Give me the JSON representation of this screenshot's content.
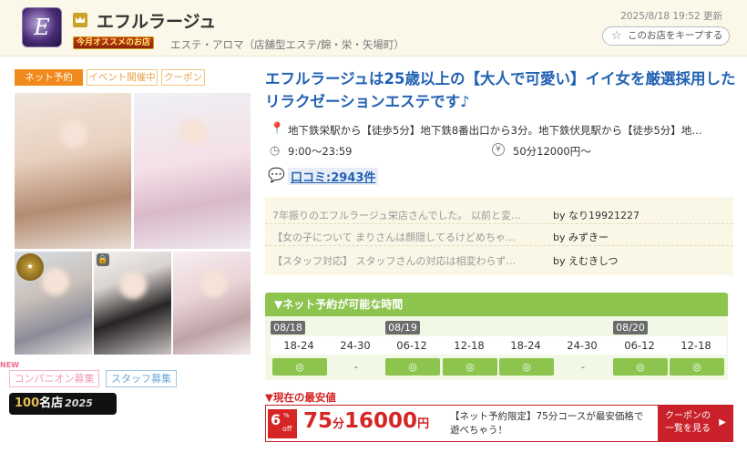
{
  "header": {
    "shop_name": "エフルラージュ",
    "badge": "今月オススメのお店",
    "category": "エステ・アロマ（店舗型エステ/錦・栄・矢場町）",
    "updated": "2025/8/18 19:52 更新",
    "keep_label": "このお店をキープする"
  },
  "tags": [
    "ネット予約",
    "イベント開催中",
    "クーポン"
  ],
  "recruit": {
    "new_mark": "NEW",
    "companion": "コンパニオン募集",
    "staff": "スタッフ募集"
  },
  "shop100": {
    "num": "100",
    "label": "名店",
    "year": "2025"
  },
  "catch_copy": "エフルラージュは25歳以上の【大人で可愛い】イイ女を厳選採用したリラクゼーションエステです♪",
  "info": {
    "access": "地下鉄栄駅から【徒歩5分】地下鉄8番出口から3分。地下鉄伏見駅から【徒歩5分】地…",
    "hours": "9:00～23:59",
    "price": "50分12000円～",
    "review_count": "口コミ:2943件"
  },
  "reviews": [
    {
      "text": "7年振りのエフルラージュ栄店さんでした。 以前と変…",
      "by": "by なり19921227"
    },
    {
      "text": "【女の子について まりさんは顔隠してるけどめちゃ…",
      "by": "by みずきー"
    },
    {
      "text": "【スタッフ対応】 スタッフさんの対応は相変わらず…",
      "by": "by えむきしつ"
    }
  ],
  "booking": {
    "title": "▼ネット予約が可能な時間",
    "dates": [
      "08/18",
      "08/19",
      "08/20"
    ],
    "slots": [
      "18-24",
      "24-30",
      "06-12",
      "12-18",
      "18-24",
      "24-30",
      "06-12",
      "12-18"
    ],
    "marks": [
      "◎",
      "-",
      "◎",
      "◎",
      "◎",
      "-",
      "◎",
      "◎"
    ]
  },
  "lowest": {
    "label": "▼現在の最安値",
    "discount_num": "6",
    "discount_unit": "%",
    "discount_off": "off",
    "price_min": "75",
    "price_min_unit": "分",
    "price_yen": "16000",
    "price_yen_unit": "円",
    "note": "【ネット予約限定】75分コースが最安価格で遊べちゃう！",
    "button_line1": "クーポンの",
    "button_line2": "一覧を見る",
    "button_arrow": "▶"
  },
  "colors": {
    "accent": "#2261b3",
    "book_green": "#8cc44e",
    "price_red": "#d52525",
    "tag_orange": "#f08a1c"
  }
}
